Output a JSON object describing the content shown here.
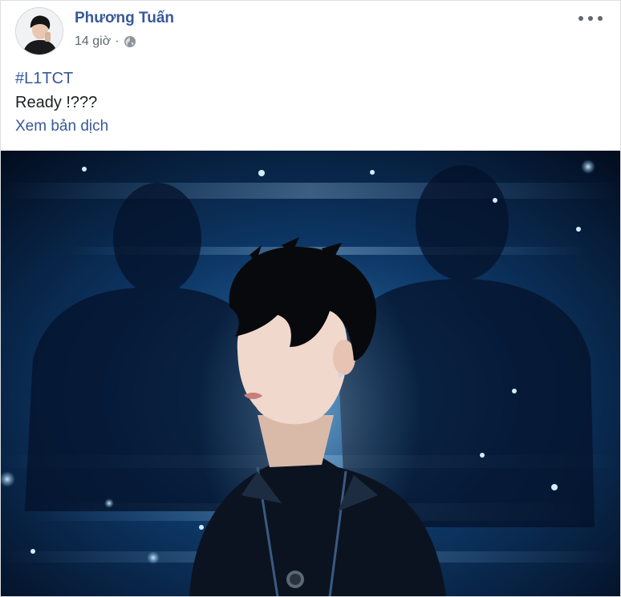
{
  "post": {
    "author_name": "Phương Tuấn",
    "time": "14 giờ",
    "separator": "·",
    "privacy_icon": "globe-icon",
    "more_icon": "more-options-icon",
    "hashtag": "#L1TCT",
    "text": "Ready !???",
    "translate_label": "Xem bản dịch"
  },
  "colors": {
    "link": "#385898",
    "meta": "#606770",
    "photo_bg": "#05152e",
    "glow": "#7ec8ff"
  }
}
